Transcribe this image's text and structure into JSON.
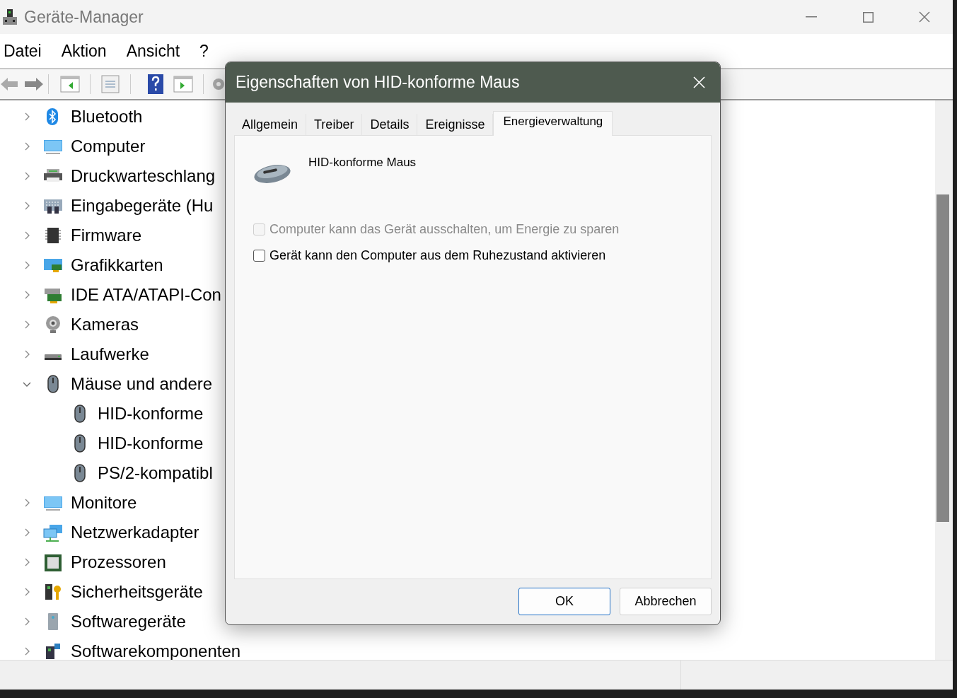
{
  "window": {
    "title": "Geräte-Manager"
  },
  "menu": [
    "Datei",
    "Aktion",
    "Ansicht",
    "?"
  ],
  "tree": [
    {
      "label": "Bluetooth",
      "expanded": false
    },
    {
      "label": "Computer",
      "expanded": false
    },
    {
      "label": "Druckwarteschlang",
      "expanded": false
    },
    {
      "label": "Eingabegeräte (Hu",
      "expanded": false
    },
    {
      "label": "Firmware",
      "expanded": false
    },
    {
      "label": "Grafikkarten",
      "expanded": false
    },
    {
      "label": "IDE ATA/ATAPI-Con",
      "expanded": false
    },
    {
      "label": "Kameras",
      "expanded": false
    },
    {
      "label": "Laufwerke",
      "expanded": false
    },
    {
      "label": "Mäuse und andere",
      "expanded": true,
      "children": [
        {
          "label": "HID-konforme"
        },
        {
          "label": "HID-konforme"
        },
        {
          "label": "PS/2-kompatibl"
        }
      ]
    },
    {
      "label": "Monitore",
      "expanded": false
    },
    {
      "label": "Netzwerkadapter",
      "expanded": false
    },
    {
      "label": "Prozessoren",
      "expanded": false
    },
    {
      "label": "Sicherheitsgeräte",
      "expanded": false
    },
    {
      "label": "Softwaregeräte",
      "expanded": false
    },
    {
      "label": "Softwarekomponenten",
      "expanded": false
    }
  ],
  "dialog": {
    "title": "Eigenschaften von HID-konforme Maus",
    "tabs": [
      {
        "label": "Allgemein",
        "selected": false
      },
      {
        "label": "Treiber",
        "selected": false
      },
      {
        "label": "Details",
        "selected": false
      },
      {
        "label": "Ereignisse",
        "selected": false
      },
      {
        "label": "Energieverwaltung",
        "selected": true
      }
    ],
    "device_name": "HID-konforme Maus",
    "options": [
      {
        "label": "Computer kann das Gerät ausschalten, um Energie zu sparen",
        "checked": false,
        "disabled": true
      },
      {
        "label": "Gerät kann den Computer aus dem Ruhezustand aktivieren",
        "checked": false,
        "disabled": false
      }
    ],
    "buttons": [
      {
        "label": "OK",
        "default": true
      },
      {
        "label": "Abbrechen",
        "default": false
      }
    ]
  }
}
